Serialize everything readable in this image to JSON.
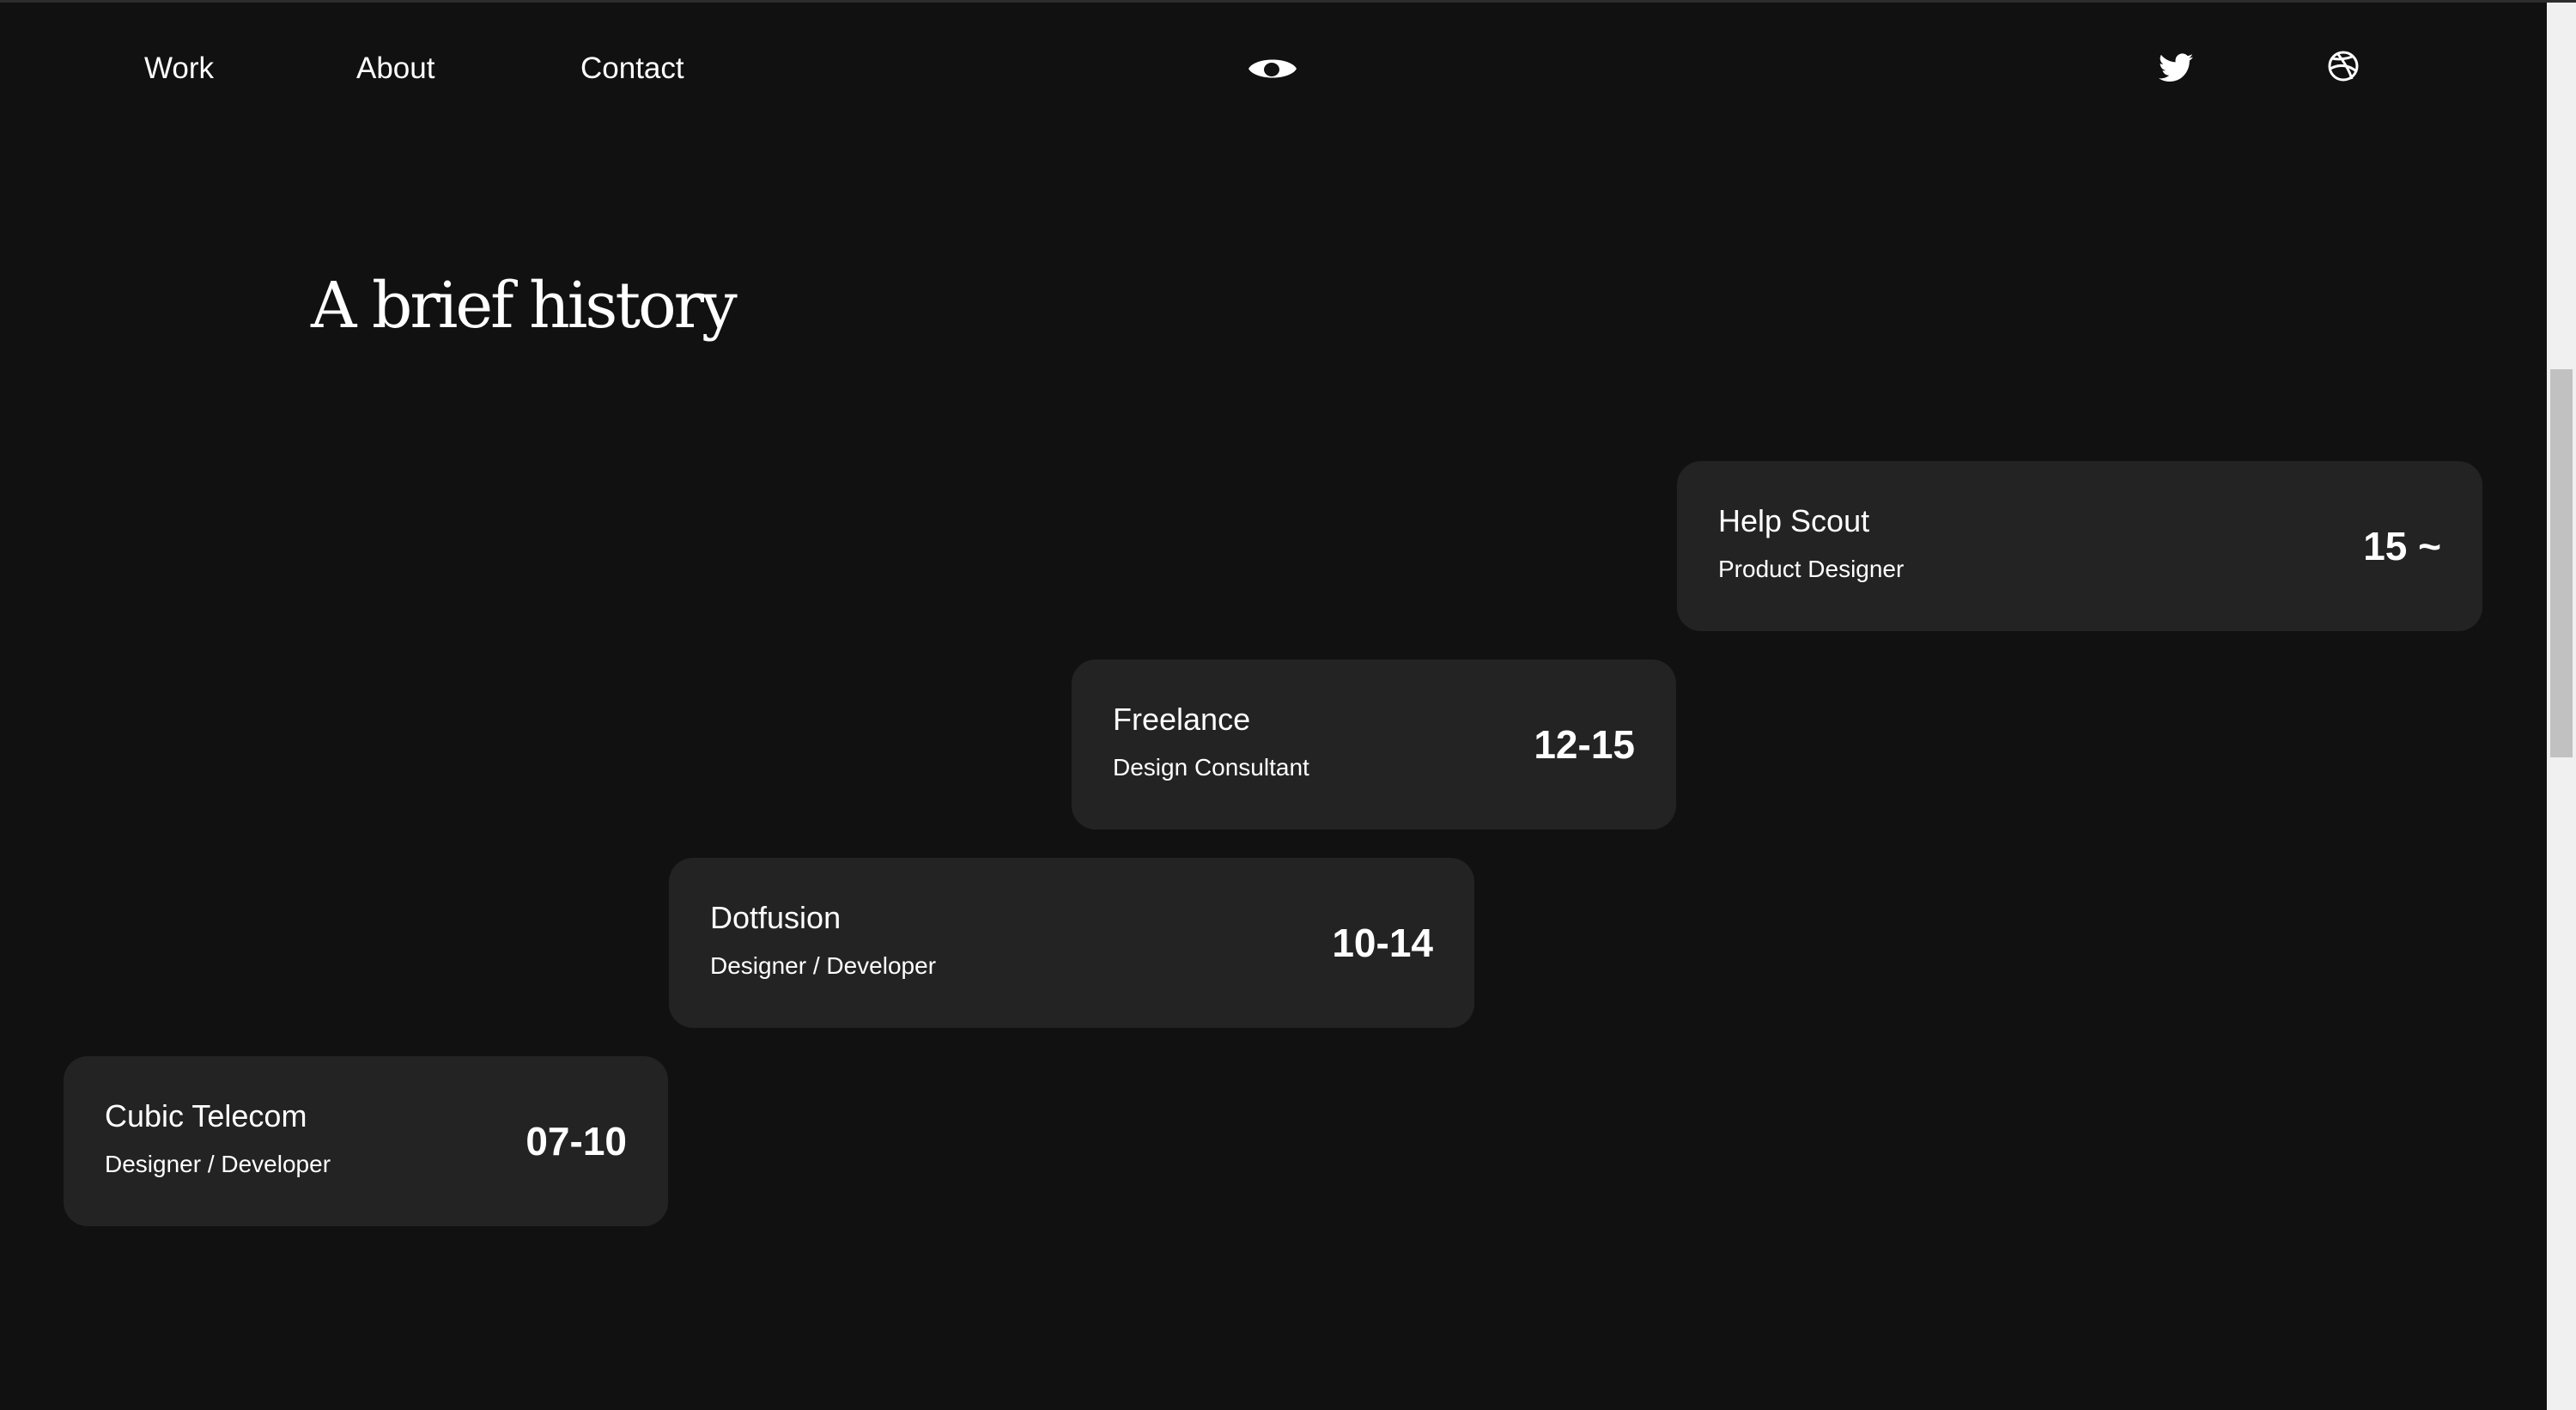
{
  "nav": {
    "work": "Work",
    "about": "About",
    "contact": "Contact"
  },
  "icons": {
    "logo": "eye-icon",
    "twitter": "twitter-icon",
    "dribbble": "dribbble-icon"
  },
  "heading": "A brief history",
  "history": [
    {
      "company": "Help Scout",
      "role": "Product Designer",
      "years": "15 ~"
    },
    {
      "company": "Freelance",
      "role": "Design Consultant",
      "years": "12-15"
    },
    {
      "company": "Dotfusion",
      "role": "Designer / Developer",
      "years": "10-14"
    },
    {
      "company": "Cubic Telecom",
      "role": "Designer / Developer",
      "years": "07-10"
    }
  ],
  "colors": {
    "background": "#111111",
    "card": "#232323",
    "text": "#ffffff"
  }
}
